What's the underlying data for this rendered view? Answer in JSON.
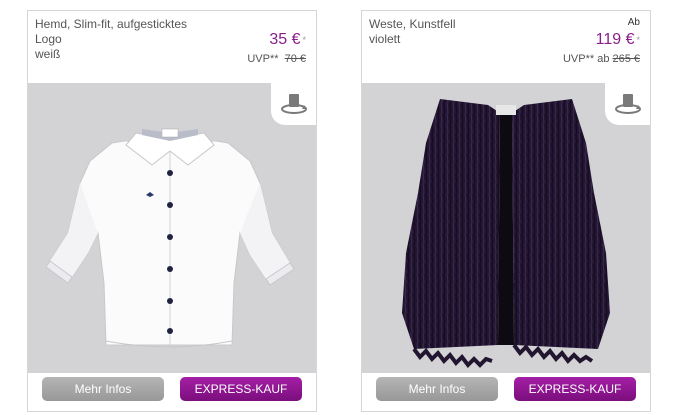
{
  "products": [
    {
      "name": "Hemd, Slim-fit, aufgesticktes Logo",
      "color": "weiß",
      "prefix": "",
      "price": "35 €",
      "price_star": "*",
      "uvp_label": "UVP**",
      "uvp_prefix": "",
      "uvp_price": "70 €",
      "more_info_label": "Mehr Infos",
      "express_label": "EXPRESS-KAUF"
    },
    {
      "name": "Weste, Kunstfell",
      "color": "violett",
      "prefix": "Ab",
      "price": "119 €",
      "price_star": "*",
      "uvp_label": "UVP**",
      "uvp_prefix": "ab",
      "uvp_price": "265 €",
      "more_info_label": "Mehr Infos",
      "express_label": "EXPRESS-KAUF"
    }
  ],
  "colors": {
    "accent": "#8a1f8a",
    "button_express": "#8e1490",
    "button_info": "#a6a6a6",
    "image_bg": "#d3d3d5"
  },
  "icons": [
    "rotate-view-icon"
  ]
}
